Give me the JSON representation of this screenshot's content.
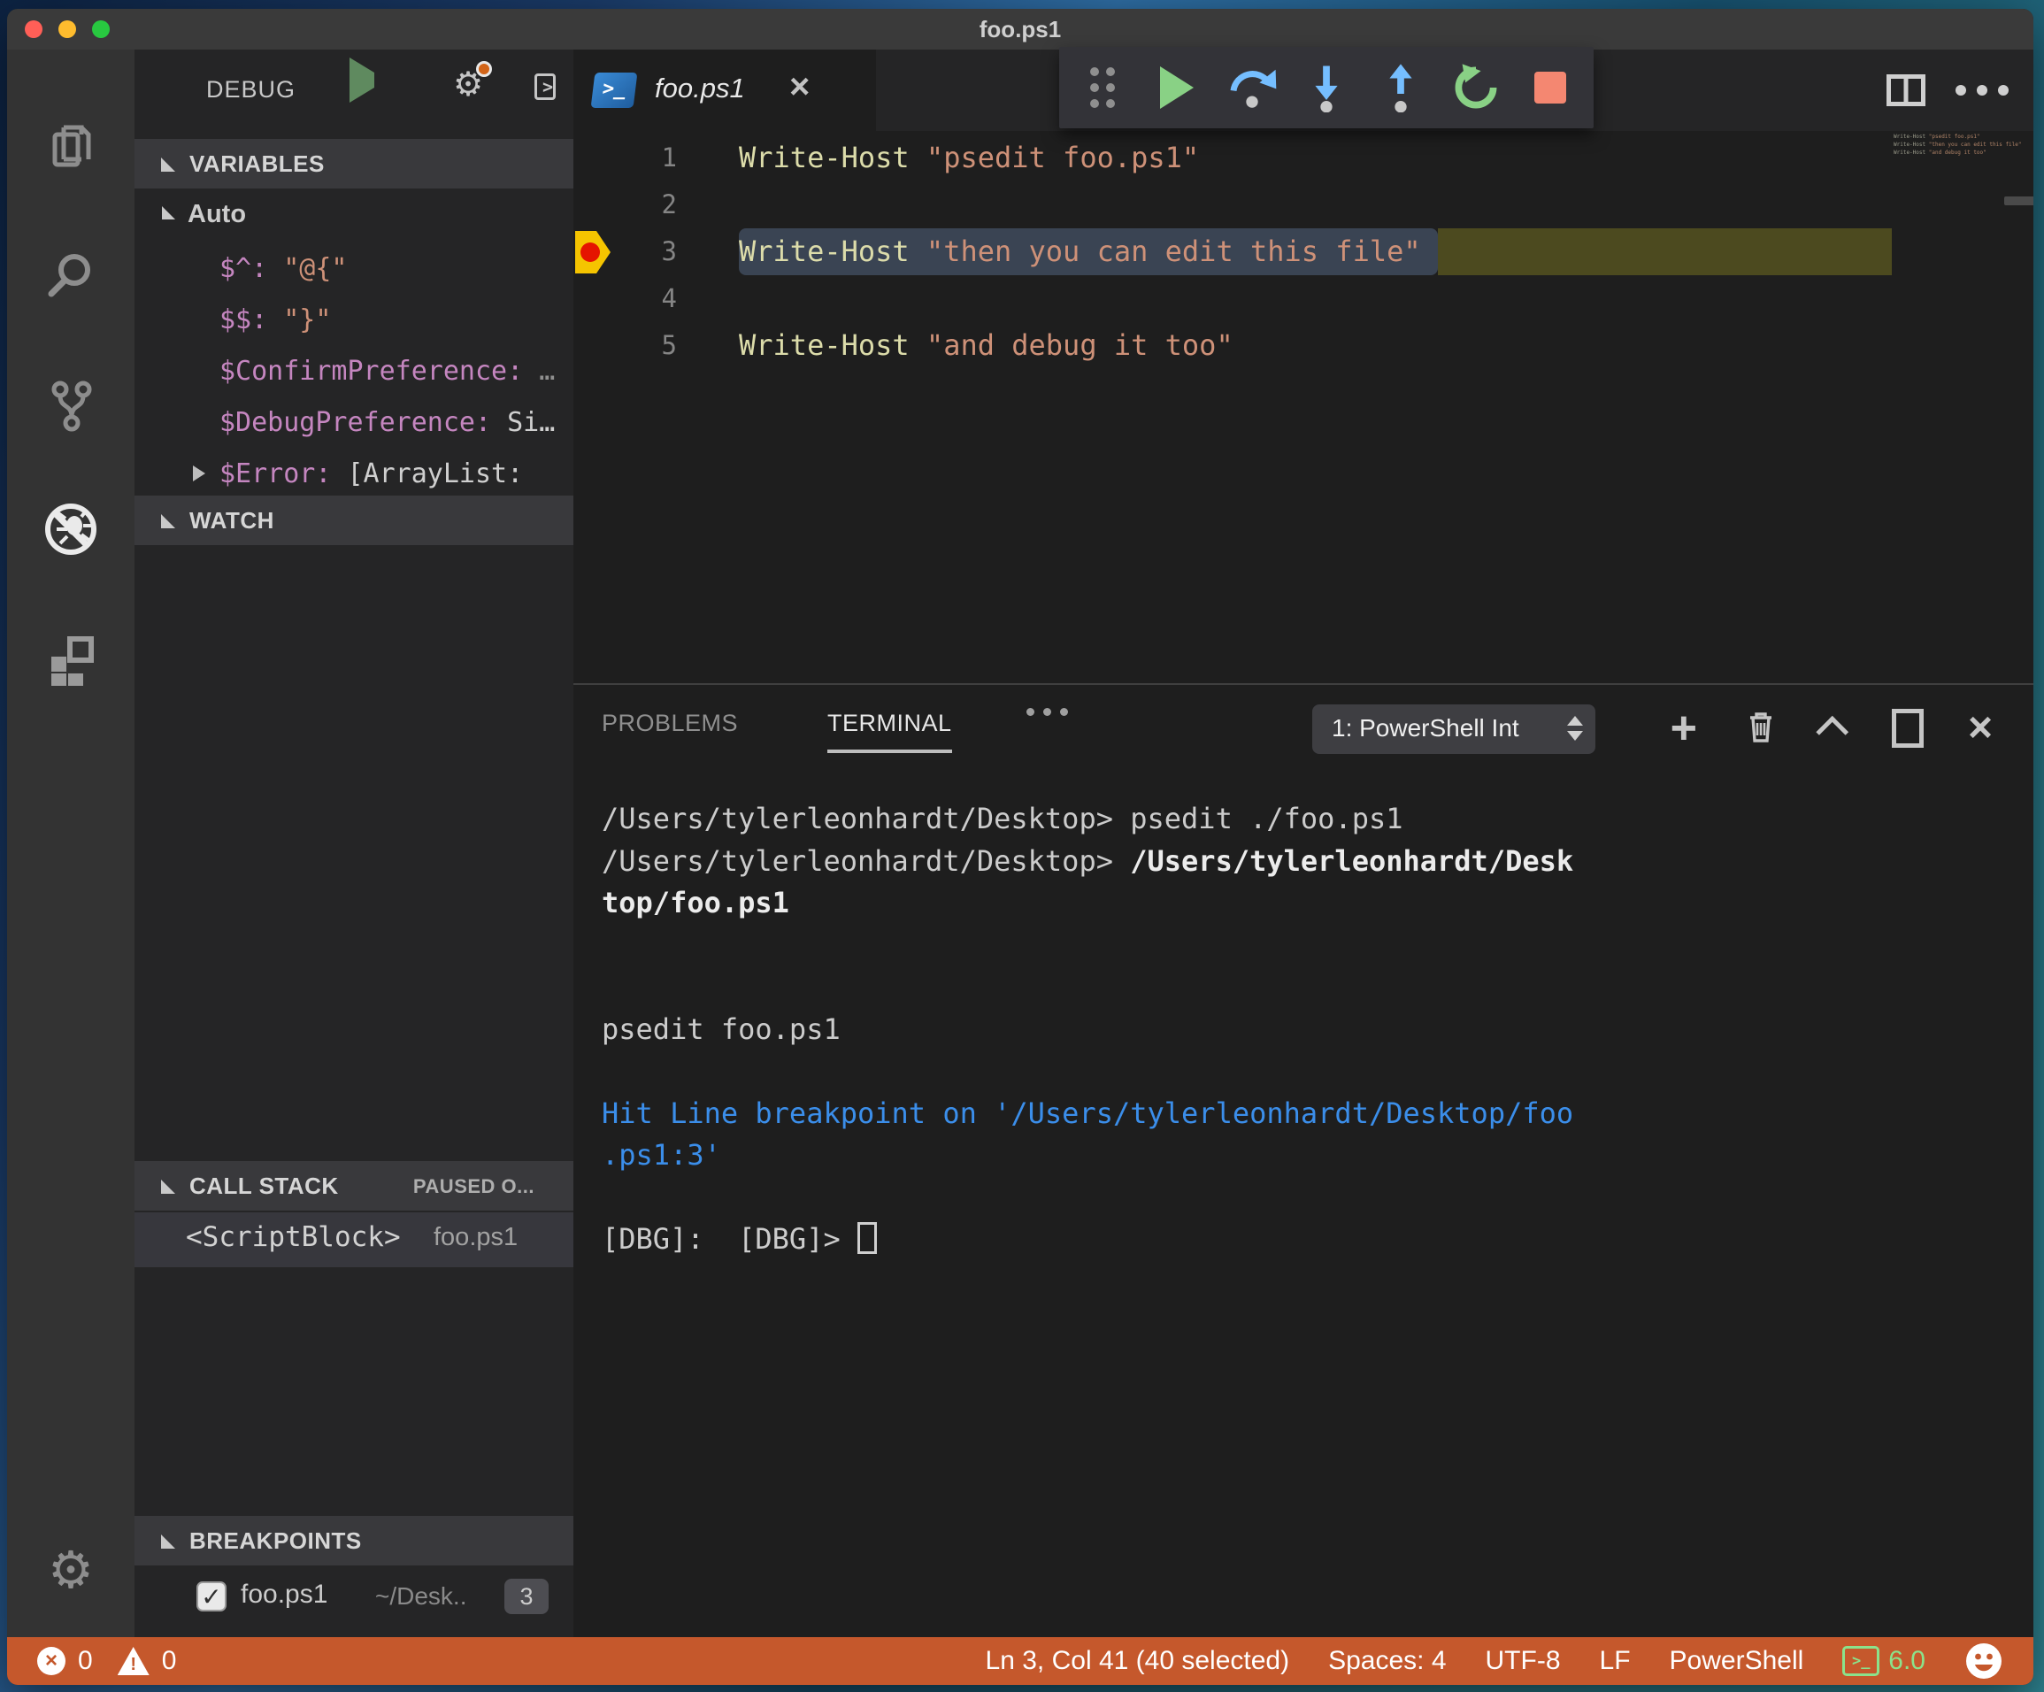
{
  "window": {
    "title": "foo.ps1"
  },
  "colors": {
    "status_bar": "#C5582C",
    "terminal_info_blue": "#3B8EEA",
    "string_orange": "#CE9178",
    "cmdlet_yellow": "#DCDCAA",
    "variable_purple": "#C586C0",
    "debug_line_highlight": "#4C4A1F",
    "ps_version_green": "#8BE28B"
  },
  "activity_bar": {
    "icons": [
      "explorer-icon",
      "search-icon",
      "source-control-icon",
      "debug-icon",
      "extensions-icon",
      "settings-gear-icon"
    ]
  },
  "sidebar": {
    "title": "DEBUG",
    "header_icons": [
      "start-debug-icon",
      "configure-gear-icon",
      "debug-console-icon"
    ],
    "variables": {
      "header": "VARIABLES",
      "group_label": "Auto",
      "rows": [
        {
          "label": "$^: ",
          "value": "\"@{\"",
          "vc": "v-str",
          "chev": false
        },
        {
          "label": "$$: ",
          "value": "\"}\"",
          "vc": "v-str",
          "chev": false
        },
        {
          "label": "$ConfirmPreference: ",
          "value": "…",
          "vc": "v-dim",
          "chev": false
        },
        {
          "label": "$DebugPreference: ",
          "value": "Si…",
          "vc": "v-plain",
          "chev": false
        },
        {
          "label": "$Error: ",
          "value": "[ArrayList:",
          "vc": "v-plain",
          "chev": true
        }
      ]
    },
    "watch": {
      "header": "WATCH"
    },
    "call_stack": {
      "header": "CALL STACK",
      "status": "PAUSED O...",
      "frames": [
        {
          "name": "<ScriptBlock>",
          "file": "foo.ps1"
        }
      ]
    },
    "breakpoints": {
      "header": "BREAKPOINTS",
      "items": [
        {
          "checked": "✓",
          "file": "foo.ps1",
          "path": "~/Desk..",
          "line": "3"
        }
      ]
    }
  },
  "editor": {
    "tab": {
      "label": "foo.ps1"
    },
    "lines": [
      {
        "num": "1",
        "code": [
          {
            "t": "Write-Host ",
            "c": "cmdlet"
          },
          {
            "t": "\"psedit foo.ps1\"",
            "c": "string"
          }
        ]
      },
      {
        "num": "2",
        "code": []
      },
      {
        "num": "3",
        "code": [
          {
            "t": "Write-Host ",
            "c": "cmdlet"
          },
          {
            "t": "\"then you can edit this file\"",
            "c": "string"
          }
        ]
      },
      {
        "num": "4",
        "code": []
      },
      {
        "num": "5",
        "code": [
          {
            "t": "Write-Host ",
            "c": "cmdlet"
          },
          {
            "t": "\"and debug it too\"",
            "c": "string"
          }
        ]
      }
    ],
    "minimap_lines": [
      "Write-Host \"psedit foo.ps1\"",
      "Write-Host \"then you can edit this file\"",
      "Write-Host \"and debug it too\""
    ]
  },
  "debug_toolbar": {
    "buttons": [
      "drag-handle",
      "continue",
      "step-over",
      "step-into",
      "step-out",
      "restart",
      "stop"
    ]
  },
  "panel": {
    "tabs": [
      {
        "label": "PROBLEMS"
      },
      {
        "label": "TERMINAL"
      }
    ],
    "terminal_select": "1: PowerShell Int",
    "action_icons": [
      "new-terminal-icon",
      "kill-terminal-icon",
      "maximize-panel-icon",
      "split-terminal-icon",
      "close-panel-icon"
    ],
    "terminal": {
      "lines": [
        {
          "segs": [
            {
              "t": "/Users/tylerleonhardt/Desktop> ",
              "s": "fg"
            },
            {
              "t": "psedit ./foo.ps1",
              "s": "fg"
            }
          ],
          "cursor": false
        },
        {
          "segs": [
            {
              "t": "/Users/tylerleonhardt/Desktop> ",
              "s": "fg"
            },
            {
              "t": "/Users/tylerleonhardt/Desk",
              "s": "bold"
            }
          ],
          "cursor": false
        },
        {
          "segs": [
            {
              "t": "top/foo.ps1",
              "s": "bold"
            }
          ],
          "cursor": false
        },
        {
          "segs": [],
          "cursor": false
        },
        {
          "segs": [],
          "cursor": false
        },
        {
          "segs": [
            {
              "t": "psedit foo.ps1",
              "s": "fg"
            }
          ],
          "cursor": false
        },
        {
          "segs": [],
          "cursor": false
        },
        {
          "segs": [
            {
              "t": "Hit Line breakpoint on '/Users/tylerleonhardt/Desktop/foo",
              "s": "blue"
            }
          ],
          "cursor": false
        },
        {
          "segs": [
            {
              "t": ".ps1:3'",
              "s": "blue"
            }
          ],
          "cursor": false
        },
        {
          "segs": [],
          "cursor": false
        },
        {
          "segs": [
            {
              "t": "[DBG]:  [DBG]> ",
              "s": "fg"
            }
          ],
          "cursor": true
        }
      ]
    }
  },
  "status_bar": {
    "errors": "0",
    "warnings": "0",
    "cursor_position": "Ln 3, Col 41 (40 selected)",
    "indentation": "Spaces: 4",
    "encoding": "UTF-8",
    "eol": "LF",
    "language": "PowerShell",
    "ps_version": "6.0"
  }
}
